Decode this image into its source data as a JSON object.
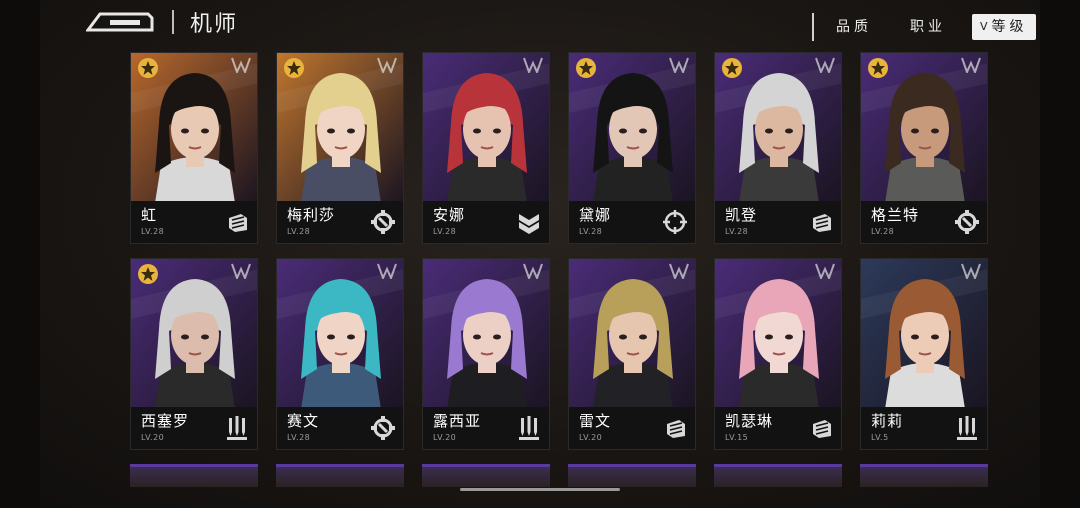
{
  "header": {
    "title": "机师",
    "sort_options": [
      {
        "label": "品质"
      },
      {
        "label": "职业"
      },
      {
        "label": "等级",
        "active": true
      }
    ]
  },
  "cards": [
    {
      "name": "虹",
      "level": "LV.28",
      "rarity": "gold",
      "class_icon": "fist-icon",
      "bg": "#b8682c",
      "hair": "#1a1412",
      "skin": "#e8c9b4",
      "outfit": "#d8d8d8"
    },
    {
      "name": "梅利莎",
      "level": "LV.28",
      "rarity": "gold",
      "class_icon": "wrench-icon",
      "bg": "#c0762e",
      "hair": "#e3cf8e",
      "skin": "#f0d5c4",
      "outfit": "#4a4e64"
    },
    {
      "name": "安娜",
      "level": "LV.28",
      "rarity": "none",
      "class_icon": "chevron-icon",
      "bg": "#4a2c78",
      "hair": "#b8343a",
      "skin": "#e6c2b0",
      "outfit": "#2a2a2a"
    },
    {
      "name": "黛娜",
      "level": "LV.28",
      "rarity": "gold",
      "class_icon": "crosshair-icon",
      "bg": "#4a2c78",
      "hair": "#141414",
      "skin": "#e2c6b6",
      "outfit": "#222222"
    },
    {
      "name": "凯登",
      "level": "LV.28",
      "rarity": "gold",
      "class_icon": "fist-icon",
      "bg": "#4a2c78",
      "hair": "#d4d4d4",
      "skin": "#dcb8a0",
      "outfit": "#3a3a3a"
    },
    {
      "name": "格兰特",
      "level": "LV.28",
      "rarity": "gold",
      "class_icon": "wrench-icon",
      "bg": "#4a2c78",
      "hair": "#3a2a20",
      "skin": "#c89a7c",
      "outfit": "#5a5a58"
    },
    {
      "name": "西塞罗",
      "level": "LV.20",
      "rarity": "gold",
      "class_icon": "missiles-icon",
      "bg": "#4a2c78",
      "hair": "#cfcfcf",
      "skin": "#dcbcac",
      "outfit": "#2a2a2a"
    },
    {
      "name": "赛文",
      "level": "LV.28",
      "rarity": "none",
      "class_icon": "wrench-icon",
      "bg": "#4a2c78",
      "hair": "#3cb8c4",
      "skin": "#f0d4c6",
      "outfit": "#3e5a7a"
    },
    {
      "name": "露西亚",
      "level": "LV.20",
      "rarity": "none",
      "class_icon": "missiles-icon",
      "bg": "#4a2c78",
      "hair": "#9a7ad0",
      "skin": "#ecd0c6",
      "outfit": "#1e1e22"
    },
    {
      "name": "雷文",
      "level": "LV.20",
      "rarity": "none",
      "class_icon": "fist-icon",
      "bg": "#4a2c78",
      "hair": "#b8a05a",
      "skin": "#e6c6ae",
      "outfit": "#222226"
    },
    {
      "name": "凯瑟琳",
      "level": "LV.15",
      "rarity": "none",
      "class_icon": "fist-icon",
      "bg": "#4a2c78",
      "hair": "#e8a6b8",
      "skin": "#f2d8d2",
      "outfit": "#2a2a2a"
    },
    {
      "name": "莉莉",
      "level": "LV.5",
      "rarity": "none",
      "class_icon": "missiles-icon",
      "bg": "#2c3a5a",
      "hair": "#9a5a34",
      "skin": "#ecccb6",
      "outfit": "#dcdcdc"
    }
  ],
  "colors": {
    "rarity_gold": "#e8b43a",
    "accent_purple": "#5a3aa0"
  }
}
